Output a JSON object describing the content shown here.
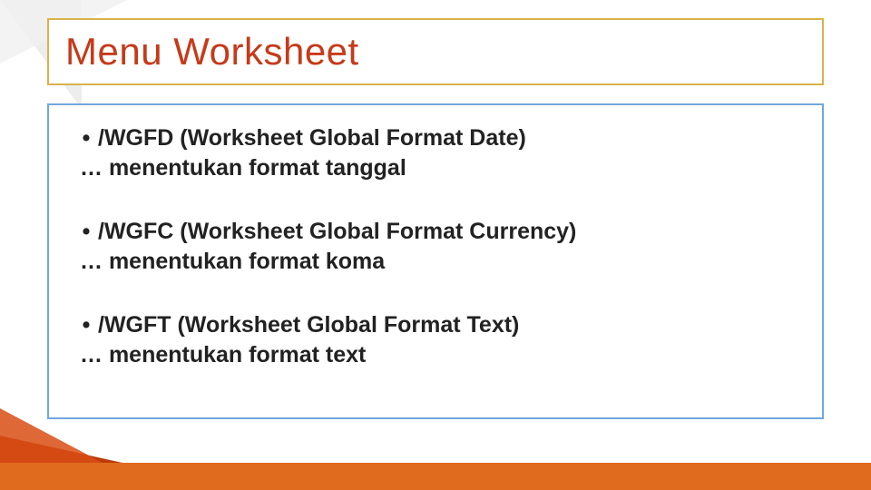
{
  "title": "Menu Worksheet",
  "items": [
    {
      "command": "/WGFD (Worksheet Global Format Date)",
      "description": "… menentukan format tanggal"
    },
    {
      "command": "/WGFC (Worksheet Global Format Currency)",
      "description": "… menentukan format koma"
    },
    {
      "command": "/WGFT (Worksheet Global Format Text)",
      "description": "… menentukan format text"
    }
  ],
  "bullet": "•"
}
